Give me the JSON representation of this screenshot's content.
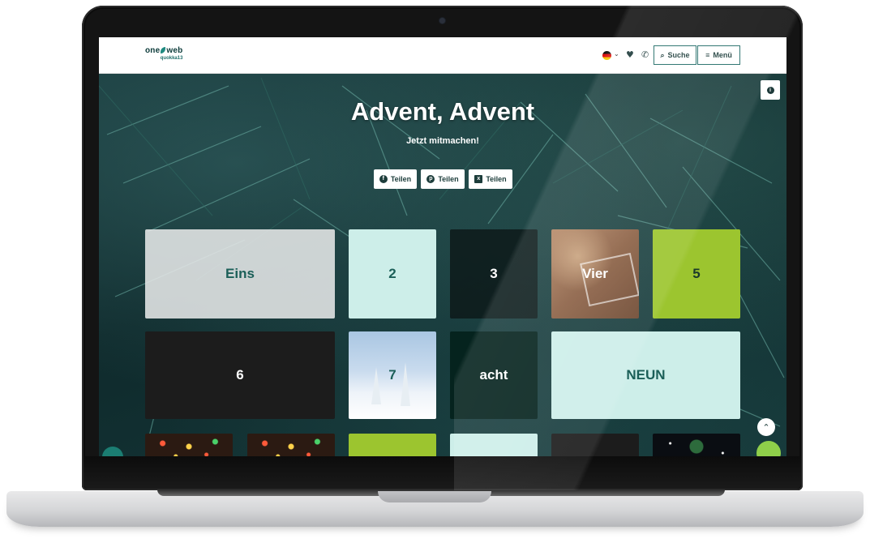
{
  "topbar": {
    "logo_main": "one",
    "logo_main2": "web",
    "logo_sub": "quokka13",
    "search_label": "Suche",
    "menu_label": "Menü"
  },
  "hero": {
    "title": "Advent, Advent",
    "subtitle": "Jetzt mitmachen!"
  },
  "share": [
    {
      "label": "Teilen",
      "icon": "facebook-icon"
    },
    {
      "label": "Teilen",
      "icon": "pinterest-icon"
    },
    {
      "label": "Teilen",
      "icon": "x-icon"
    }
  ],
  "tiles": {
    "t1": "Eins",
    "t2": "2",
    "t3": "3",
    "t4": "Vier",
    "t5": "5",
    "t6": "6",
    "t7": "7",
    "t8": "acht",
    "t9": "NEUN"
  },
  "colors": {
    "brand_dark": "#1d3d3b",
    "mint": "#cdeee9",
    "lime": "#9cc52f"
  }
}
